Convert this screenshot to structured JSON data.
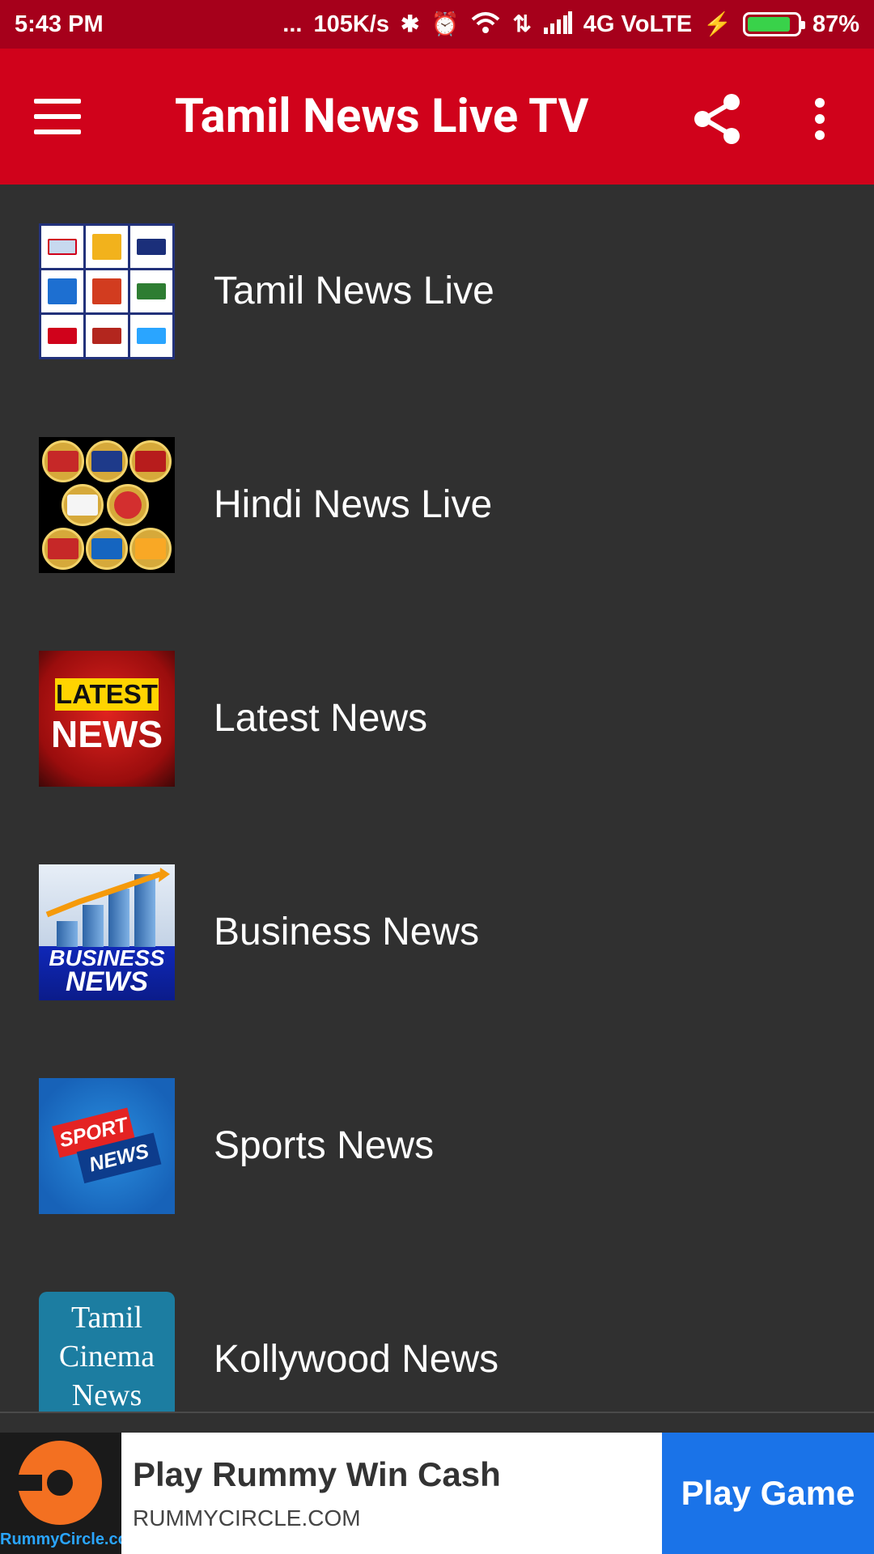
{
  "status_bar": {
    "time": "5:43 PM",
    "dots": "...",
    "net_speed": "105K/s",
    "network": "4G VoLTE",
    "battery": "87%",
    "battery_level": 0.87
  },
  "toolbar": {
    "title": "Tamil News Live TV"
  },
  "list": {
    "items": [
      {
        "label": "Tamil News Live"
      },
      {
        "label": "Hindi News Live"
      },
      {
        "label": "Latest News"
      },
      {
        "label": "Business News"
      },
      {
        "label": "Sports News"
      },
      {
        "label": "Kollywood News"
      }
    ]
  },
  "thumbs": {
    "latest_top": "LATEST",
    "latest_bottom": "NEWS",
    "business_top": "BUSINESS",
    "business_bottom": "NEWS",
    "sport_1": "SPORT",
    "sport_2": "NEWS",
    "kolly": [
      "Tamil",
      "Cinema",
      "News"
    ]
  },
  "ad": {
    "title": "Play Rummy Win Cash",
    "subtitle": "RUMMYCIRCLE.COM",
    "cta": "Play Game",
    "logo_text": "RummyCircle.com"
  },
  "colors": {
    "toolbar": "#d0021b",
    "status_bar": "#a6001b",
    "background": "#303030",
    "ad_cta": "#1a73e8"
  }
}
